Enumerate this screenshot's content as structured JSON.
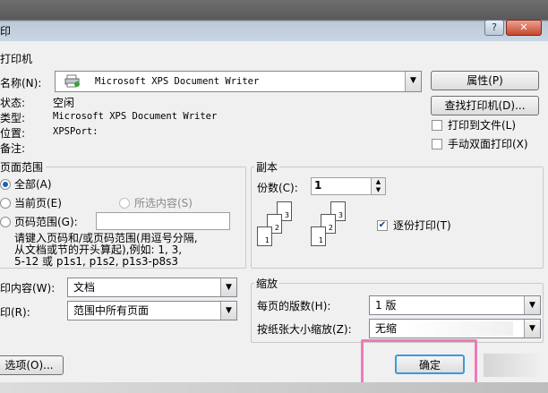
{
  "window": {
    "title": "印"
  },
  "printer": {
    "group_title": "打印机",
    "name_label": "名称(N):",
    "name_value": "Microsoft XPS Document Writer",
    "properties_button": "属性(P)",
    "find_button": "查找打印机(D)...",
    "print_to_file": "打印到文件(L)",
    "duplex_manual": "手动双面打印(X)",
    "status_label": "状态:",
    "status_value": "空闲",
    "type_label": "类型:",
    "type_value": "Microsoft XPS Document Writer",
    "location_label": "位置:",
    "location_value": "XPSPort:",
    "comment_label": "备注:"
  },
  "page_range": {
    "group_title": "页面范围",
    "all": "全部(A)",
    "current": "当前页(E)",
    "selection": "所选内容(S)",
    "pages": "页码范围(G):",
    "hint_line1": "请键入页码和/或页码范围(用逗号分隔,",
    "hint_line2": "从文档或节的开头算起),例如: 1, 3,",
    "hint_line3": "5-12 或 p1s1, p1s2, p1s3-p8s3"
  },
  "copies": {
    "group_title": "副本",
    "count_label": "份数(C):",
    "count_value": "1",
    "collate": "逐份打印(T)",
    "page_numbers": [
      "1",
      "2",
      "3"
    ]
  },
  "print_what": {
    "label": "印内容(W):",
    "value": "文档"
  },
  "print_range": {
    "label": "印(R):",
    "value": "范围中所有页面"
  },
  "zoom": {
    "group_title": "缩放",
    "pages_per_sheet_label": "每页的版数(H):",
    "pages_per_sheet_value": "1 版",
    "scale_label": "按纸张大小缩放(Z):",
    "scale_value": "无缩"
  },
  "footer": {
    "options_button": "选项(O)...",
    "ok_button": "确定"
  }
}
